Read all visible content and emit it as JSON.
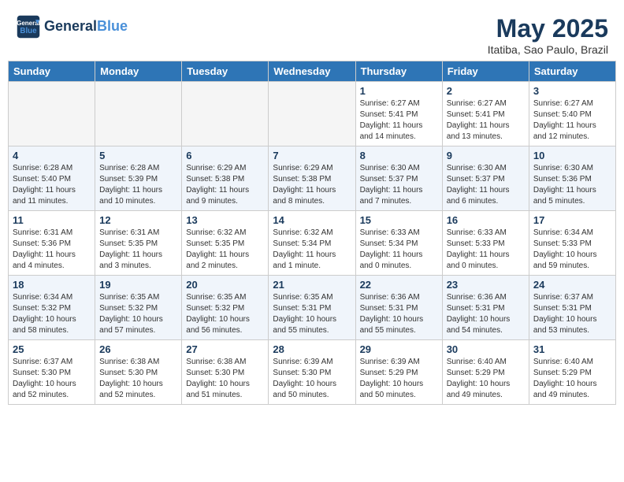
{
  "header": {
    "logo_line1": "General",
    "logo_line2": "Blue",
    "title": "May 2025",
    "subtitle": "Itatiba, Sao Paulo, Brazil"
  },
  "days_of_week": [
    "Sunday",
    "Monday",
    "Tuesday",
    "Wednesday",
    "Thursday",
    "Friday",
    "Saturday"
  ],
  "weeks": [
    [
      {
        "day": "",
        "info": ""
      },
      {
        "day": "",
        "info": ""
      },
      {
        "day": "",
        "info": ""
      },
      {
        "day": "",
        "info": ""
      },
      {
        "day": "1",
        "info": "Sunrise: 6:27 AM\nSunset: 5:41 PM\nDaylight: 11 hours and 14 minutes."
      },
      {
        "day": "2",
        "info": "Sunrise: 6:27 AM\nSunset: 5:41 PM\nDaylight: 11 hours and 13 minutes."
      },
      {
        "day": "3",
        "info": "Sunrise: 6:27 AM\nSunset: 5:40 PM\nDaylight: 11 hours and 12 minutes."
      }
    ],
    [
      {
        "day": "4",
        "info": "Sunrise: 6:28 AM\nSunset: 5:40 PM\nDaylight: 11 hours and 11 minutes."
      },
      {
        "day": "5",
        "info": "Sunrise: 6:28 AM\nSunset: 5:39 PM\nDaylight: 11 hours and 10 minutes."
      },
      {
        "day": "6",
        "info": "Sunrise: 6:29 AM\nSunset: 5:38 PM\nDaylight: 11 hours and 9 minutes."
      },
      {
        "day": "7",
        "info": "Sunrise: 6:29 AM\nSunset: 5:38 PM\nDaylight: 11 hours and 8 minutes."
      },
      {
        "day": "8",
        "info": "Sunrise: 6:30 AM\nSunset: 5:37 PM\nDaylight: 11 hours and 7 minutes."
      },
      {
        "day": "9",
        "info": "Sunrise: 6:30 AM\nSunset: 5:37 PM\nDaylight: 11 hours and 6 minutes."
      },
      {
        "day": "10",
        "info": "Sunrise: 6:30 AM\nSunset: 5:36 PM\nDaylight: 11 hours and 5 minutes."
      }
    ],
    [
      {
        "day": "11",
        "info": "Sunrise: 6:31 AM\nSunset: 5:36 PM\nDaylight: 11 hours and 4 minutes."
      },
      {
        "day": "12",
        "info": "Sunrise: 6:31 AM\nSunset: 5:35 PM\nDaylight: 11 hours and 3 minutes."
      },
      {
        "day": "13",
        "info": "Sunrise: 6:32 AM\nSunset: 5:35 PM\nDaylight: 11 hours and 2 minutes."
      },
      {
        "day": "14",
        "info": "Sunrise: 6:32 AM\nSunset: 5:34 PM\nDaylight: 11 hours and 1 minute."
      },
      {
        "day": "15",
        "info": "Sunrise: 6:33 AM\nSunset: 5:34 PM\nDaylight: 11 hours and 0 minutes."
      },
      {
        "day": "16",
        "info": "Sunrise: 6:33 AM\nSunset: 5:33 PM\nDaylight: 11 hours and 0 minutes."
      },
      {
        "day": "17",
        "info": "Sunrise: 6:34 AM\nSunset: 5:33 PM\nDaylight: 10 hours and 59 minutes."
      }
    ],
    [
      {
        "day": "18",
        "info": "Sunrise: 6:34 AM\nSunset: 5:32 PM\nDaylight: 10 hours and 58 minutes."
      },
      {
        "day": "19",
        "info": "Sunrise: 6:35 AM\nSunset: 5:32 PM\nDaylight: 10 hours and 57 minutes."
      },
      {
        "day": "20",
        "info": "Sunrise: 6:35 AM\nSunset: 5:32 PM\nDaylight: 10 hours and 56 minutes."
      },
      {
        "day": "21",
        "info": "Sunrise: 6:35 AM\nSunset: 5:31 PM\nDaylight: 10 hours and 55 minutes."
      },
      {
        "day": "22",
        "info": "Sunrise: 6:36 AM\nSunset: 5:31 PM\nDaylight: 10 hours and 55 minutes."
      },
      {
        "day": "23",
        "info": "Sunrise: 6:36 AM\nSunset: 5:31 PM\nDaylight: 10 hours and 54 minutes."
      },
      {
        "day": "24",
        "info": "Sunrise: 6:37 AM\nSunset: 5:31 PM\nDaylight: 10 hours and 53 minutes."
      }
    ],
    [
      {
        "day": "25",
        "info": "Sunrise: 6:37 AM\nSunset: 5:30 PM\nDaylight: 10 hours and 52 minutes."
      },
      {
        "day": "26",
        "info": "Sunrise: 6:38 AM\nSunset: 5:30 PM\nDaylight: 10 hours and 52 minutes."
      },
      {
        "day": "27",
        "info": "Sunrise: 6:38 AM\nSunset: 5:30 PM\nDaylight: 10 hours and 51 minutes."
      },
      {
        "day": "28",
        "info": "Sunrise: 6:39 AM\nSunset: 5:30 PM\nDaylight: 10 hours and 50 minutes."
      },
      {
        "day": "29",
        "info": "Sunrise: 6:39 AM\nSunset: 5:29 PM\nDaylight: 10 hours and 50 minutes."
      },
      {
        "day": "30",
        "info": "Sunrise: 6:40 AM\nSunset: 5:29 PM\nDaylight: 10 hours and 49 minutes."
      },
      {
        "day": "31",
        "info": "Sunrise: 6:40 AM\nSunset: 5:29 PM\nDaylight: 10 hours and 49 minutes."
      }
    ]
  ]
}
